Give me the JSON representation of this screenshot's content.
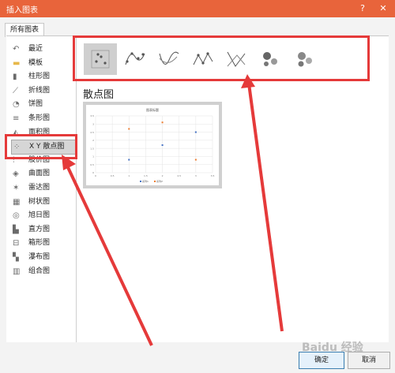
{
  "window": {
    "title": "插入图表",
    "help_label": "?",
    "close_label": "✕"
  },
  "tabs": [
    {
      "label": "所有图表"
    }
  ],
  "sidebar": {
    "items": [
      {
        "label": "最近",
        "icon": "undo-icon"
      },
      {
        "label": "模板",
        "icon": "folder-icon"
      },
      {
        "label": "柱形图",
        "icon": "column-chart-icon"
      },
      {
        "label": "折线图",
        "icon": "line-chart-icon"
      },
      {
        "label": "饼图",
        "icon": "pie-chart-icon"
      },
      {
        "label": "条形图",
        "icon": "bar-chart-icon"
      },
      {
        "label": "面积图",
        "icon": "area-chart-icon"
      },
      {
        "label": "X Y 散点图",
        "icon": "scatter-chart-icon",
        "selected": true
      },
      {
        "label": "股价图",
        "icon": "stock-chart-icon"
      },
      {
        "label": "曲面图",
        "icon": "surface-chart-icon"
      },
      {
        "label": "雷达图",
        "icon": "radar-chart-icon"
      },
      {
        "label": "树状图",
        "icon": "treemap-chart-icon"
      },
      {
        "label": "旭日图",
        "icon": "sunburst-chart-icon"
      },
      {
        "label": "直方图",
        "icon": "histogram-chart-icon"
      },
      {
        "label": "箱形图",
        "icon": "boxwhisker-chart-icon"
      },
      {
        "label": "瀑布图",
        "icon": "waterfall-chart-icon"
      },
      {
        "label": "组合图",
        "icon": "combo-chart-icon"
      }
    ]
  },
  "subtypes": [
    {
      "icon": "scatter-icon",
      "selected": true
    },
    {
      "icon": "scatter-smooth-markers-icon"
    },
    {
      "icon": "scatter-smooth-lines-icon"
    },
    {
      "icon": "scatter-straight-markers-icon"
    },
    {
      "icon": "scatter-straight-lines-icon"
    },
    {
      "icon": "bubble-icon"
    },
    {
      "icon": "bubble-3d-icon"
    }
  ],
  "main": {
    "section_title": "散点图"
  },
  "chart_data": {
    "type": "scatter",
    "title": "图表标题",
    "series": [
      {
        "name": "系列1",
        "color": "#4472c4",
        "points": [
          [
            1,
            0.8
          ],
          [
            2,
            1.7
          ],
          [
            3,
            2.5
          ]
        ]
      },
      {
        "name": "系列2",
        "color": "#ed7d31",
        "points": [
          [
            1,
            2.7
          ],
          [
            2,
            3.1
          ],
          [
            3,
            0.8
          ]
        ]
      }
    ],
    "xlim": [
      0,
      3.5
    ],
    "ylim": [
      0,
      3.5
    ],
    "xticks": [
      "0",
      "0.5",
      "1",
      "1.5",
      "2",
      "2.5",
      "3",
      "3.5"
    ],
    "yticks": [
      "0",
      "0.5",
      "1",
      "1.5",
      "2",
      "2.5",
      "3",
      "3.5"
    ],
    "grid": true,
    "legend": "bottom"
  },
  "buttons": {
    "ok": "确定",
    "cancel": "取消"
  },
  "watermark": "Baidu 经验",
  "colors": {
    "titlebar": "#e8643b",
    "annotation_red": "#e53a3a"
  }
}
